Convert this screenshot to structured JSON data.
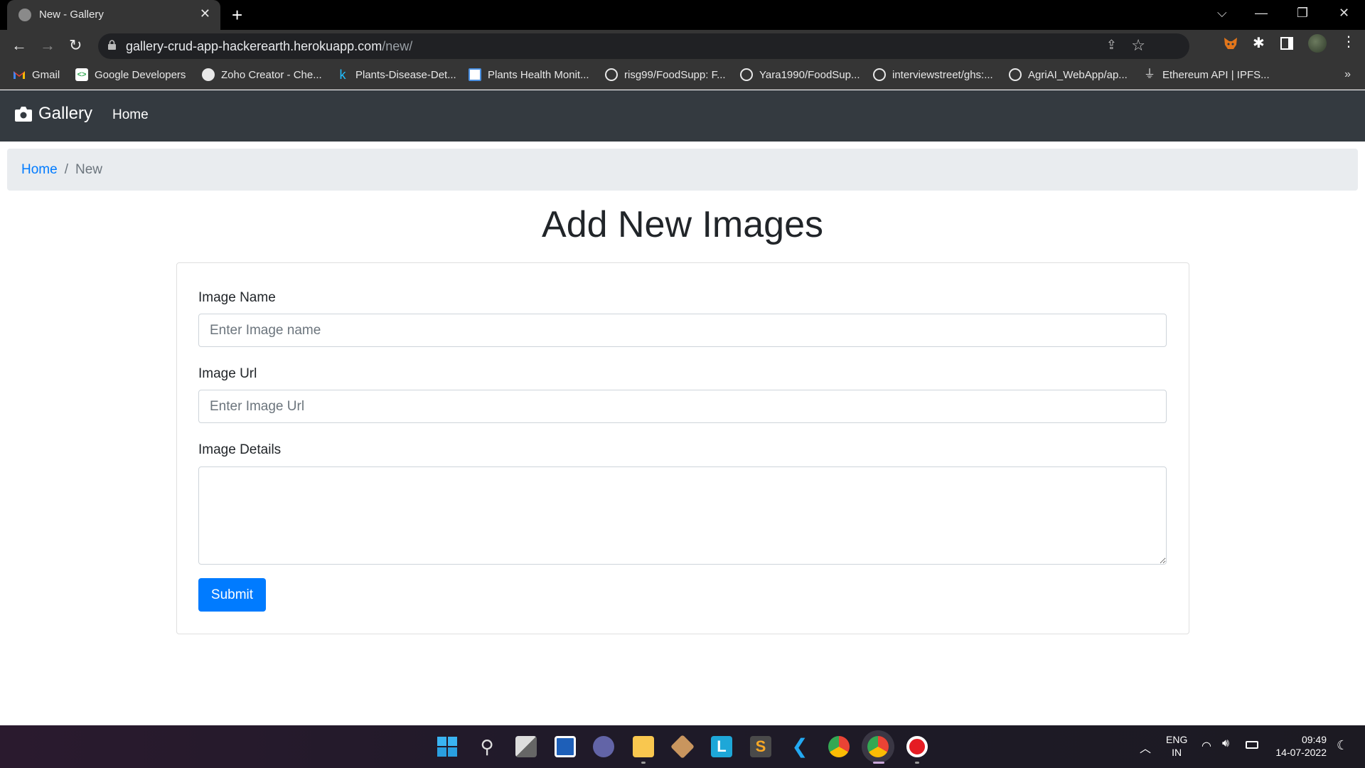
{
  "browser": {
    "tab_title": "New - Gallery",
    "new_tab_label": "+",
    "url_host": "gallery-crud-app-hackerearth.herokuapp.com",
    "url_path": "/new/",
    "bookmarks": [
      {
        "label": "Gmail",
        "icon": "gmail-icon"
      },
      {
        "label": "Google Developers",
        "icon": "google-developers-icon"
      },
      {
        "label": "Zoho Creator - Che...",
        "icon": "globe-icon"
      },
      {
        "label": "Plants-Disease-Det...",
        "icon": "kaggle-icon"
      },
      {
        "label": "Plants Health Monit...",
        "icon": "chat-bubble-icon"
      },
      {
        "label": "risg99/FoodSupp: F...",
        "icon": "github-icon"
      },
      {
        "label": "Yara1990/FoodSup...",
        "icon": "github-icon"
      },
      {
        "label": "interviewstreet/ghs:...",
        "icon": "github-icon"
      },
      {
        "label": "AgriAI_WebApp/ap...",
        "icon": "github-icon"
      },
      {
        "label": "Ethereum API | IPFS...",
        "icon": "infura-icon"
      }
    ],
    "bookmarks_overflow": "»"
  },
  "navbar": {
    "brand": "Gallery",
    "home_link": "Home"
  },
  "breadcrumb": {
    "home": "Home",
    "separator": "/",
    "current": "New"
  },
  "page": {
    "title": "Add New Images"
  },
  "form": {
    "name_label": "Image Name",
    "name_placeholder": "Enter Image name",
    "name_value": "",
    "url_label": "Image Url",
    "url_placeholder": "Enter Image Url",
    "url_value": "",
    "details_label": "Image Details",
    "details_value": "",
    "submit_label": "Submit"
  },
  "colors": {
    "primary": "#007bff",
    "navbar": "#343a40",
    "breadcrumb_bg": "#e9ecef"
  },
  "taskbar": {
    "apps": [
      "windows-start-icon",
      "search-icon",
      "task-view-icon",
      "widgets-icon",
      "teams-chat-icon",
      "file-explorer-icon",
      "package-icon",
      "l-app-icon",
      "sublime-text-icon",
      "vscode-icon",
      "chrome-icon",
      "chrome-icon-active",
      "recorder-icon"
    ],
    "language_line1": "ENG",
    "language_line2": "IN",
    "time": "09:49",
    "date": "14-07-2022"
  }
}
